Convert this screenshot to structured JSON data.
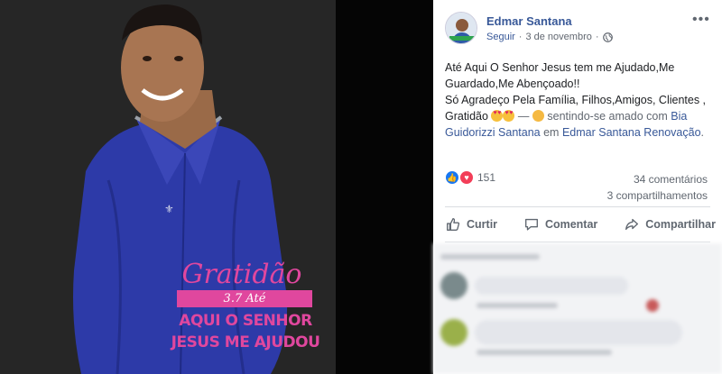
{
  "post": {
    "author": "Edmar Santana",
    "follow_label": "Seguir",
    "separator": "·",
    "date": "3 de novembro",
    "more_label": "•••",
    "text": {
      "line1": "Até Aqui O Senhor Jesus tem me Ajudado,Me",
      "line2": "Guardado,Me Abençoado!!",
      "line3": "Só Agradeço Pela Família, Filhos,Amigos, Clientes ,",
      "line4_start": "Gratidão",
      "feeling": "— ",
      "feeling_text": "sentindo-se amado com",
      "tag1": "Bia Guidorizzi Santana",
      "in_text": "em",
      "tag2": "Edmar Santana Renovação",
      "period": "."
    }
  },
  "stats": {
    "reactions_count": "151",
    "comments": "34 comentários",
    "shares": "3 compartilhamentos"
  },
  "actions": {
    "like": "Curtir",
    "comment": "Comentar",
    "share": "Compartilhar"
  },
  "photo": {
    "overlay_title": "Gratidão",
    "overlay_ref": "3.7 Até",
    "overlay_line1": "AQUI O SENHOR",
    "overlay_line2": "JESUS ME AJUDOU"
  },
  "colors": {
    "link": "#385898",
    "overlay_pink": "#e0479e",
    "shirt": "#2d3aa8"
  }
}
